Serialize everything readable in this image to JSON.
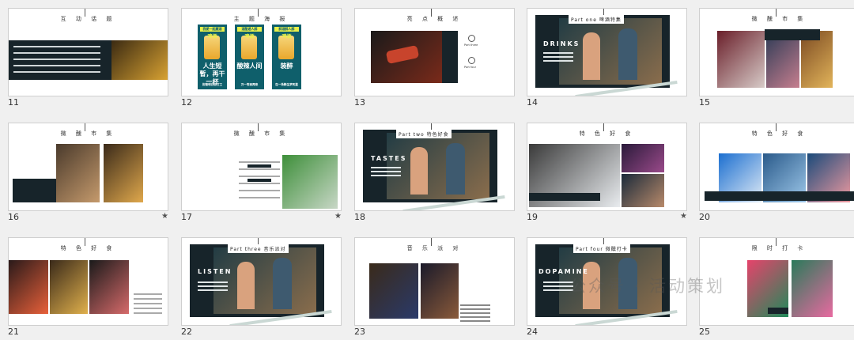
{
  "slides": [
    {
      "num": "11",
      "title": "互 动 话 题",
      "star": false
    },
    {
      "num": "12",
      "title": "主 题 海 报",
      "star": false,
      "posters": [
        {
          "top": "我愛一起麗酒",
          "mid": "啤酒",
          "main": "人生短暫，再干一杯",
          "bottom": "別管明日去打工"
        },
        {
          "top": "酒酣遊人醉",
          "mid": "啤酒",
          "main": "酸辣人间",
          "bottom": "万一等到再来"
        },
        {
          "top": "醉酒醉人醉",
          "mid": "啤酒",
          "main": "装醉",
          "bottom": "在一场醉生梦死里"
        }
      ]
    },
    {
      "num": "13",
      "title": "亮 点 概 述",
      "star": false,
      "items": [
        {
          "label": "Part three"
        },
        {
          "label": "Part four"
        }
      ]
    },
    {
      "num": "14",
      "title": "",
      "star": false,
      "part": "Part one 啤酒特集",
      "word": "DRINKS"
    },
    {
      "num": "15",
      "title": "微 醺 市 集",
      "star": false
    },
    {
      "num": "16",
      "title": "微 醺 市 集",
      "star": true
    },
    {
      "num": "17",
      "title": "微 醺 市 集",
      "star": true
    },
    {
      "num": "18",
      "title": "",
      "star": false,
      "part": "Part two 特色好食",
      "word": "TASTES"
    },
    {
      "num": "19",
      "title": "特 色 好 食",
      "star": true
    },
    {
      "num": "20",
      "title": "特 色 好 食",
      "star": false
    },
    {
      "num": "21",
      "title": "特 色 好 食",
      "star": false
    },
    {
      "num": "22",
      "title": "",
      "star": false,
      "part": "Part three 音乐派对",
      "word": "LISTEN"
    },
    {
      "num": "23",
      "title": "音 乐 派 对",
      "star": false
    },
    {
      "num": "24",
      "title": "",
      "star": false,
      "part": "Part four 微醺打卡",
      "word": "DOPAMINE"
    },
    {
      "num": "25",
      "title": "限 时 打 卡",
      "star": false
    }
  ],
  "watermark": "公众号 · 活动策划",
  "colors": {
    "dark": "#17242a",
    "poster": "#0f5f6b",
    "accent": "#3a6b5e"
  }
}
